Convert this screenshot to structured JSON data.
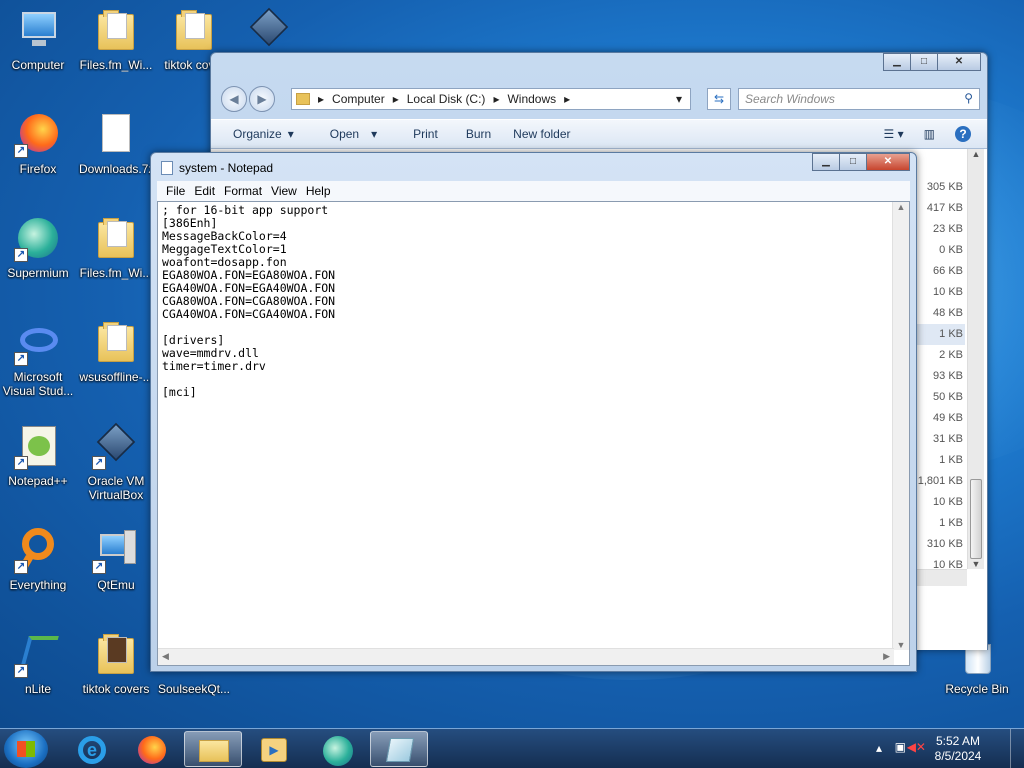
{
  "desktop": {
    "icons": [
      {
        "label": "Computer",
        "shortcut": false,
        "icon": "computer-icon"
      },
      {
        "label": "Files.fm_Wi...",
        "shortcut": false,
        "icon": "folder-icon"
      },
      {
        "label": "tiktok cov...",
        "shortcut": false,
        "icon": "folder-icon"
      },
      {
        "label": "Firefox",
        "shortcut": true,
        "icon": "firefox-icon"
      },
      {
        "label": "Downloads.7z",
        "shortcut": false,
        "icon": "file-icon"
      },
      {
        "label": "Supermium",
        "shortcut": true,
        "icon": "supermium-icon"
      },
      {
        "label": "Files.fm_Wi...",
        "shortcut": false,
        "icon": "folder-icon"
      },
      {
        "label": "Microsoft Visual Stud...",
        "shortcut": true,
        "icon": "visual-studio-icon"
      },
      {
        "label": "wsusoffline-...",
        "shortcut": false,
        "icon": "folder-icon"
      },
      {
        "label": "Notepad++",
        "shortcut": true,
        "icon": "notepadpp-icon"
      },
      {
        "label": "Oracle VM VirtualBox",
        "shortcut": true,
        "icon": "virtualbox-icon"
      },
      {
        "label": "Everything",
        "shortcut": true,
        "icon": "everything-icon"
      },
      {
        "label": "QtEmu",
        "shortcut": true,
        "icon": "qtemu-icon"
      },
      {
        "label": "nLite",
        "shortcut": true,
        "icon": "nlite-icon"
      },
      {
        "label": "tiktok covers",
        "shortcut": false,
        "icon": "folder-icon"
      },
      {
        "label": "SoulseekQt...",
        "shortcut": false,
        "icon": "soulseek-icon"
      },
      {
        "label": "Recycle Bin",
        "shortcut": false,
        "icon": "recycle-bin-icon"
      }
    ]
  },
  "explorer": {
    "breadcrumb": [
      "Computer",
      "Local Disk (C:)",
      "Windows"
    ],
    "search_placeholder": "Search Windows",
    "commands": [
      "Organize",
      "Open",
      "Print",
      "Burn",
      "New folder"
    ],
    "sizes": [
      "305 KB",
      "417 KB",
      "23 KB",
      "0 KB",
      "66 KB",
      "10 KB",
      "48 KB",
      "1 KB",
      "2 KB",
      "93 KB",
      "50 KB",
      "49 KB",
      "31 KB",
      "1 KB",
      "1,801 KB",
      "10 KB",
      "1 KB",
      "310 KB",
      "10 KB"
    ],
    "selected_size_index": 7
  },
  "notepad": {
    "title": "system - Notepad",
    "menu": [
      "File",
      "Edit",
      "Format",
      "View",
      "Help"
    ],
    "content": "; for 16-bit app support\n[386Enh]\nMessageBackColor=4\nMeggageTextColor=1\nwoafont=dosapp.fon\nEGA80WOA.FON=EGA80WOA.FON\nEGA40WOA.FON=EGA40WOA.FON\nCGA80WOA.FON=CGA80WOA.FON\nCGA40WOA.FON=CGA40WOA.FON\n\n[drivers]\nwave=mmdrv.dll\ntimer=timer.drv\n\n[mci]"
  },
  "taskbar": {
    "time": "5:52 AM",
    "date": "8/5/2024"
  }
}
